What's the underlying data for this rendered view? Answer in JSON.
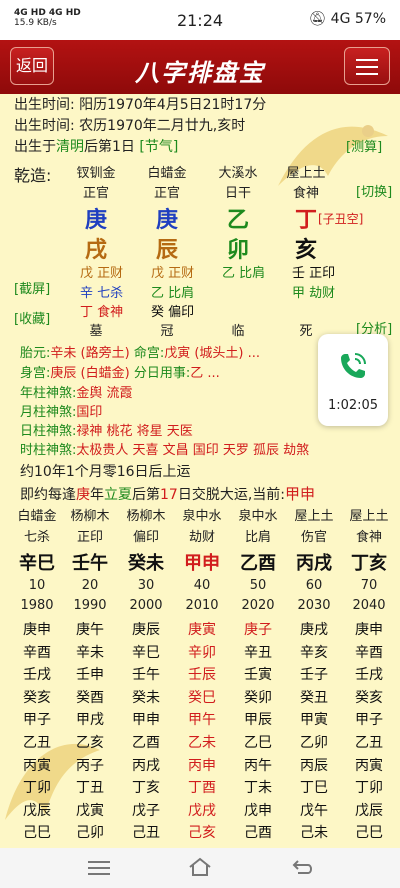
{
  "status_bar": {
    "signal": "4G HD 4G HD",
    "speed": "15.9 KB/s",
    "time": "21:24",
    "battery": "4G 57%"
  },
  "header": {
    "back": "返回",
    "title": "八字排盘宝"
  },
  "birth": {
    "l1_label": "出生时间:",
    "l1_value": "阳历1970年4月5日21时17分",
    "l2_label": "出生时间:",
    "l2_value": "农历1970年二月廿九,亥时",
    "l3_pre": "出生于",
    "l3_term": "清明",
    "l3_post": "后第1日",
    "l3_tag": "[节气]",
    "l3_calc": "[测算]"
  },
  "qianzao": {
    "label": "乾造:",
    "switch": "[切换]",
    "screenshot": "[截屏]",
    "collect": "[收藏]",
    "analysis": "[分析]",
    "kongwang": "[子丑空]",
    "nayin": [
      "钗钏金",
      "白蜡金",
      "大溪水",
      "屋上土"
    ],
    "shishen": [
      "正官",
      "正官",
      "日干",
      "食神"
    ],
    "tiangan": [
      "庚",
      "庚",
      "乙",
      "丁"
    ],
    "dizhi": [
      "戌",
      "辰",
      "卯",
      "亥"
    ],
    "canggan1": [
      "戊 正财",
      "戊 正财",
      "乙 比肩",
      "壬 正印"
    ],
    "canggan2": [
      "辛 七杀",
      "乙 比肩",
      "",
      "甲 劫财"
    ],
    "canggan3": [
      "丁 食神",
      "癸 偏印",
      "",
      ""
    ],
    "changsheng": [
      "墓",
      "冠",
      "临",
      "死"
    ]
  },
  "palaces": {
    "taiyuan_label": "胎元:",
    "taiyuan": "辛未 (路旁土)",
    "minggong_label": "命宫:",
    "minggong": "戊寅 (城头土) ...",
    "shengong_label": "身宫:",
    "shengong": "庚辰 (白蜡金)",
    "fenri_label": "分日用事:",
    "fenri": "乙 ..."
  },
  "shensha": [
    {
      "label": "年柱神煞:",
      "value": "金舆 流霞"
    },
    {
      "label": "月柱神煞:",
      "value": "国印"
    },
    {
      "label": "日柱神煞:",
      "value": "禄神 桃花 将星 天医"
    },
    {
      "label": "时柱神煞:",
      "value": "太极贵人 天喜 文昌 国印 天罗 孤辰 劫煞"
    }
  ],
  "qiyun": {
    "l1": "约10年1个月零16日后上运",
    "l2_pre": "即约每逢",
    "l2_gan": "庚",
    "l2_mid1": "年",
    "l2_term": "立夏",
    "l2_mid2": "后第",
    "l2_day": "17",
    "l2_mid3": "日交脱大运,当前:",
    "l2_cur": "甲申"
  },
  "dayun": {
    "nayin": [
      "白蜡金",
      "杨柳木",
      "杨柳木",
      "泉中水",
      "泉中水",
      "屋上土",
      "屋上土"
    ],
    "shishen": [
      "七杀",
      "正印",
      "偏印",
      "劫财",
      "比肩",
      "伤官",
      "食神"
    ],
    "ganzhi": [
      "辛巳",
      "壬午",
      "癸未",
      "甲申",
      "乙酉",
      "丙戌",
      "丁亥"
    ],
    "ages": [
      "10",
      "20",
      "30",
      "40",
      "50",
      "60",
      "70"
    ],
    "years": [
      "1980",
      "1990",
      "2000",
      "2010",
      "2020",
      "2030",
      "2040"
    ],
    "liunian": [
      [
        "庚申",
        "庚午",
        "庚辰",
        "庚寅",
        "庚子",
        "庚戌",
        "庚申"
      ],
      [
        "辛酉",
        "辛未",
        "辛巳",
        "辛卯",
        "辛丑",
        "辛亥",
        "辛酉"
      ],
      [
        "壬戌",
        "壬申",
        "壬午",
        "壬辰",
        "壬寅",
        "壬子",
        "壬戌"
      ],
      [
        "癸亥",
        "癸酉",
        "癸未",
        "癸巳",
        "癸卯",
        "癸丑",
        "癸亥"
      ],
      [
        "甲子",
        "甲戌",
        "甲申",
        "甲午",
        "甲辰",
        "甲寅",
        "甲子"
      ],
      [
        "乙丑",
        "乙亥",
        "乙酉",
        "乙未",
        "乙巳",
        "乙卯",
        "乙丑"
      ],
      [
        "丙寅",
        "丙子",
        "丙戌",
        "丙申",
        "丙午",
        "丙辰",
        "丙寅"
      ],
      [
        "丁卯",
        "丁丑",
        "丁亥",
        "丁酉",
        "丁未",
        "丁巳",
        "丁卯"
      ],
      [
        "戊辰",
        "戊寅",
        "戊子",
        "戊戌",
        "戊申",
        "戊午",
        "戊辰"
      ],
      [
        "己巳",
        "己卯",
        "己丑",
        "己亥",
        "己酉",
        "己未",
        "己巳"
      ]
    ]
  },
  "call": {
    "duration": "1:02:05"
  }
}
